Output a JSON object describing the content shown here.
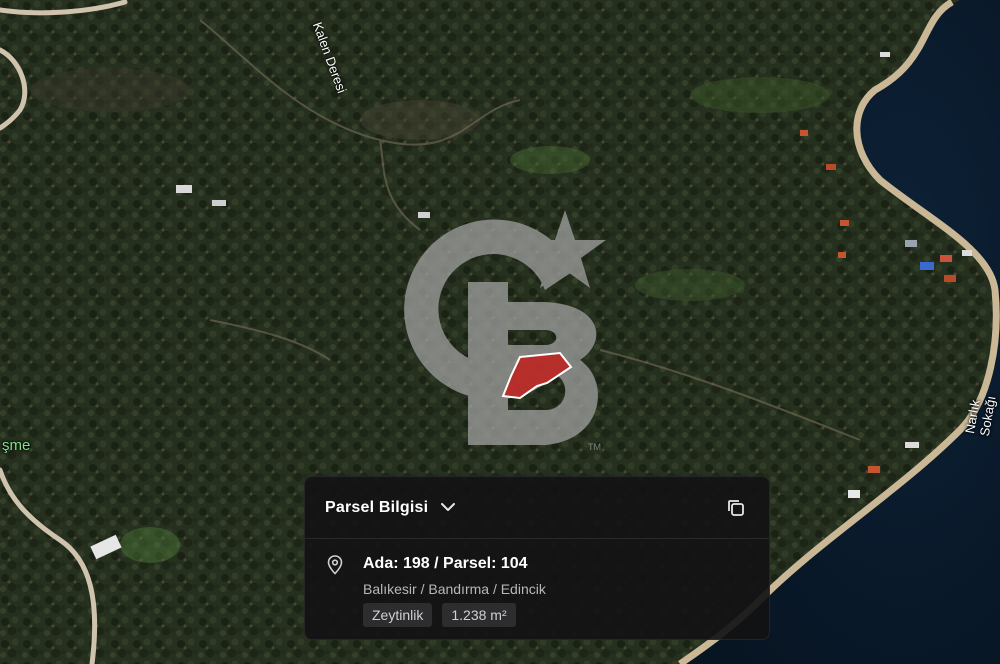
{
  "map": {
    "labels": {
      "stream": "Kalen Deresi",
      "street": "Narlık Sokağı",
      "place": "şme"
    },
    "colors": {
      "terrain": "#27311f",
      "sea": "#0b1a2c",
      "shore": "#c9b796",
      "road": "#cfc3ad",
      "parcel": "#c0201c"
    }
  },
  "watermark": {
    "text": "CB",
    "mark": "TM"
  },
  "panel": {
    "title": "Parsel Bilgisi",
    "parcel": "Ada: 198 / Parsel: 104",
    "location": "Balıkesir / Bandırma / Edincik",
    "tags": [
      "Zeytinlik",
      "1.238 m²"
    ],
    "icons": {
      "expand": "chevron-down-icon",
      "copy": "copy-icon",
      "location": "location-pin-icon"
    }
  }
}
